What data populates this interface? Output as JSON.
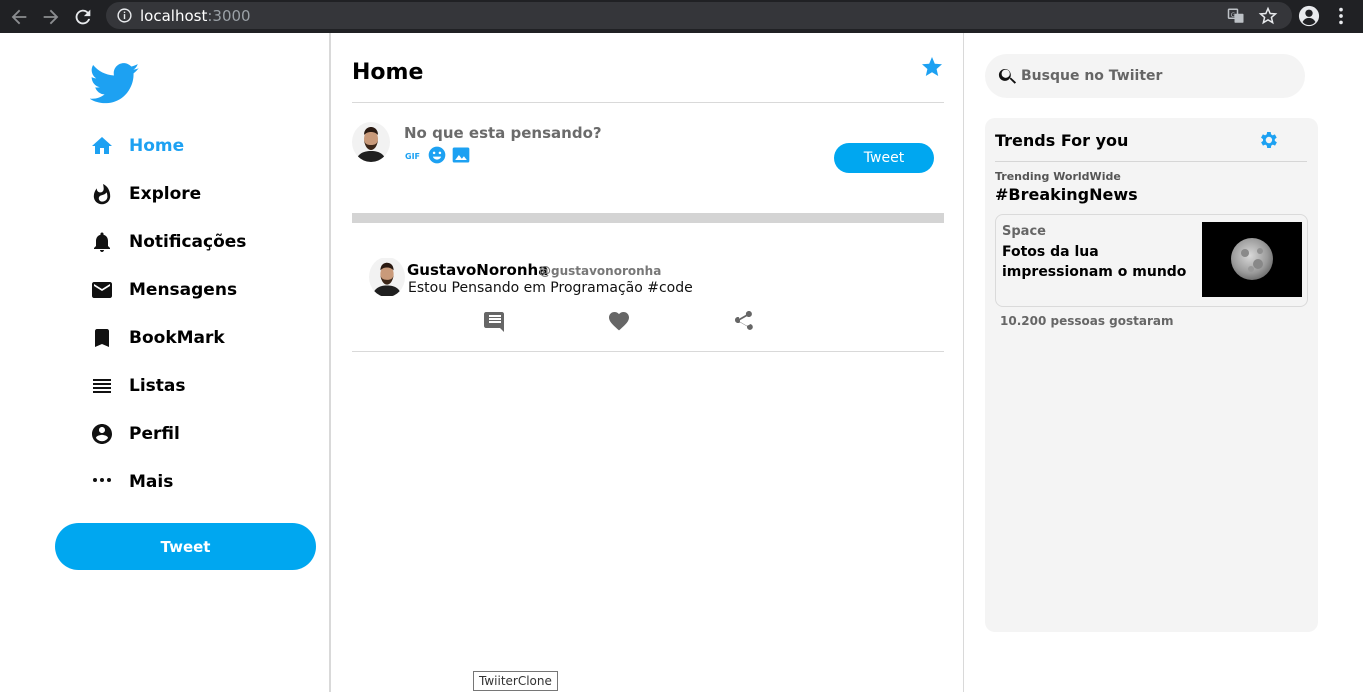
{
  "browser": {
    "url_host": "localhost",
    "url_port": ":3000",
    "icons": [
      "back-icon",
      "forward-icon",
      "reload-icon",
      "info-icon",
      "translate-icon",
      "bookmark-star-icon",
      "account-icon",
      "menu-icon"
    ]
  },
  "sidebar": {
    "logo": "twitter-bird-icon",
    "items": [
      {
        "label": "Home",
        "icon": "home-icon",
        "active": true
      },
      {
        "label": "Explore",
        "icon": "fire-icon"
      },
      {
        "label": "Notificações",
        "icon": "bell-icon"
      },
      {
        "label": "Mensagens",
        "icon": "mail-icon"
      },
      {
        "label": "BookMark",
        "icon": "bookmark-icon"
      },
      {
        "label": "Listas",
        "icon": "list-icon"
      },
      {
        "label": "Perfil",
        "icon": "profile-icon"
      },
      {
        "label": "Mais",
        "icon": "more-icon"
      }
    ],
    "tweet_button": "Tweet"
  },
  "feed": {
    "title": "Home",
    "compose": {
      "placeholder": "No que esta pensando?",
      "gif_label": "GIF",
      "tweet_button": "Tweet"
    },
    "post": {
      "name": "GustavoNoronha",
      "handle": "@gustavonoronha",
      "text": "Estou Pensando em Programação #code"
    }
  },
  "right": {
    "search_placeholder": "Busque no Twiiter",
    "trends": {
      "title": "Trends For you",
      "trending_label": "Trending WorldWide",
      "tag": "#BreakingNews",
      "card": {
        "category": "Space",
        "title": "Fotos da lua impressionam o mundo"
      },
      "likes": "10.200 pessoas gostaram"
    }
  },
  "tooltip": "TwiiterClone",
  "colors": {
    "accent": "#1da1f2",
    "button": "#00a7f0",
    "chrome": "#202124"
  }
}
